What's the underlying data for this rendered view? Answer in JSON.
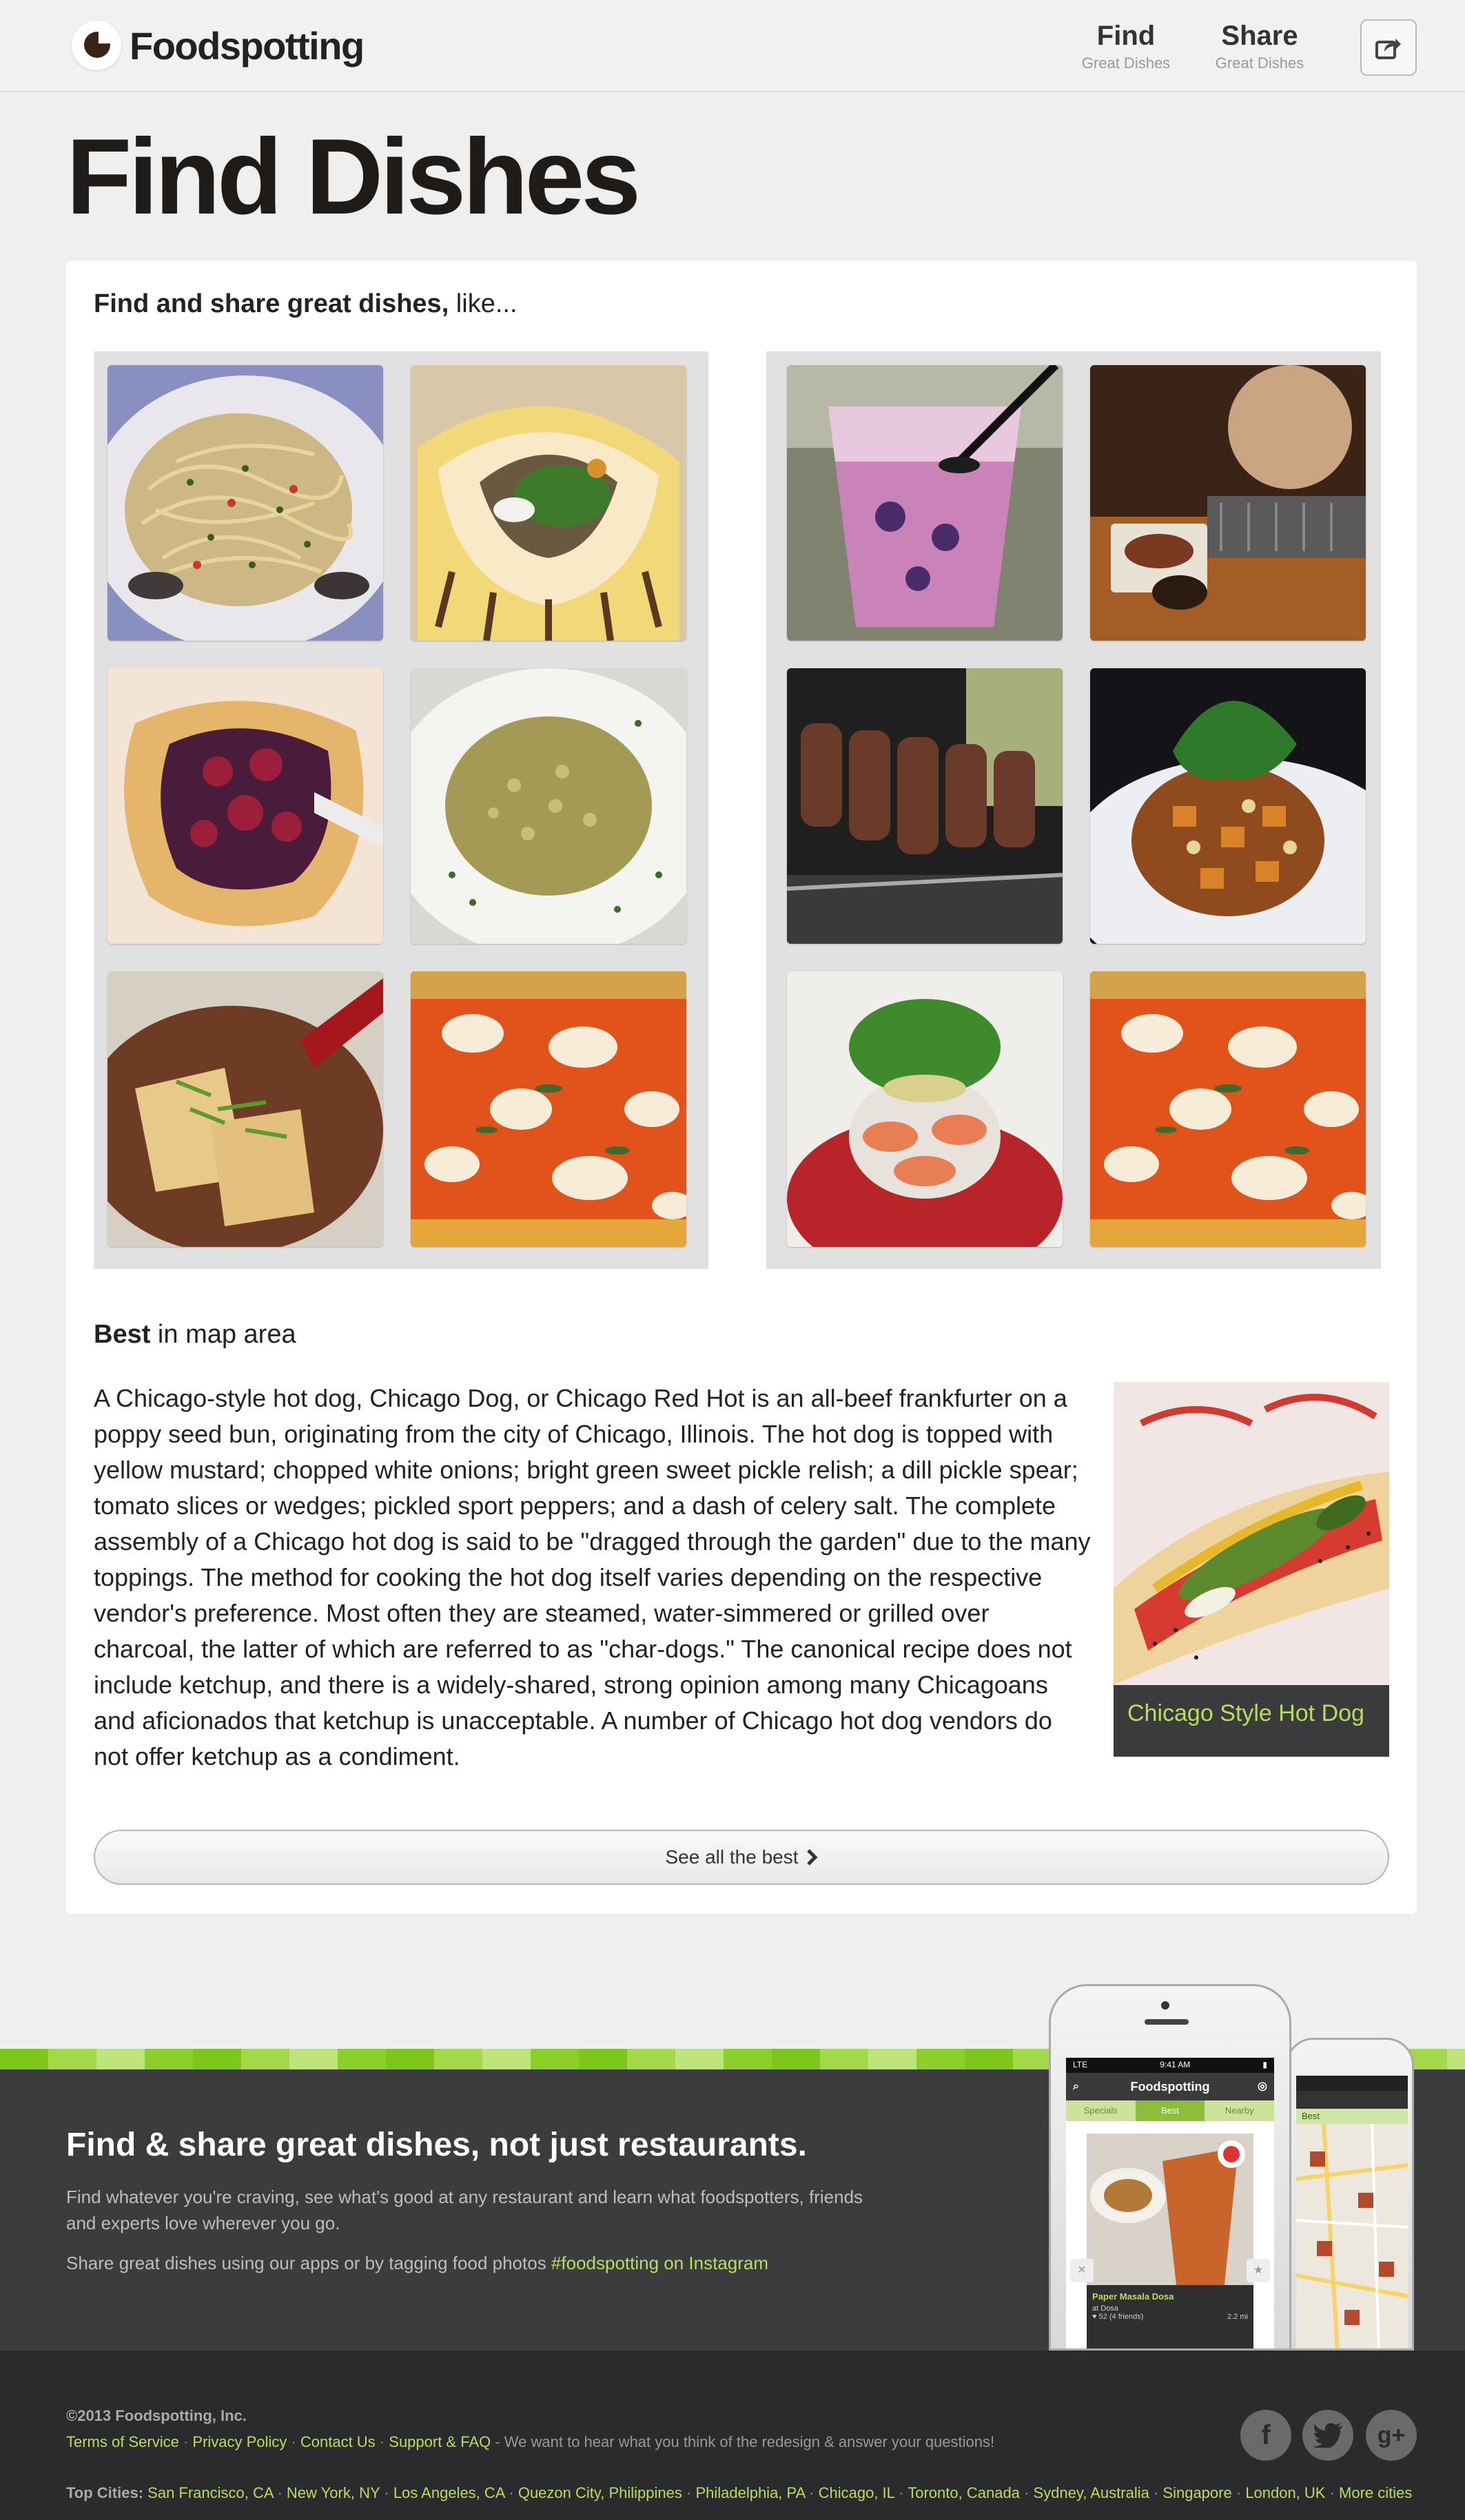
{
  "brand": {
    "name": "Foodspotting"
  },
  "nav": {
    "find": {
      "label": "Find",
      "sub": "Great Dishes"
    },
    "share": {
      "label": "Share",
      "sub": "Great Dishes"
    }
  },
  "page": {
    "title": "Find Dishes"
  },
  "intro": {
    "bold": "Find and share great dishes,",
    "rest": " like..."
  },
  "tiles": [
    "pasta",
    "gyro",
    "berry-tart",
    "risotto",
    "tofu",
    "pizza",
    "cocktail",
    "grill",
    "rotisserie",
    "salad-plate",
    "shrimp",
    "pizza"
  ],
  "best": {
    "heading_bold": "Best",
    "heading_rest": " in map area",
    "description": "A Chicago-style hot dog, Chicago Dog, or Chicago Red Hot is an all-beef frankfurter on a poppy seed bun, originating from the city of Chicago, Illinois. The hot dog is topped with yellow mustard; chopped white onions; bright green sweet pickle relish; a dill pickle spear; tomato slices or wedges; pickled sport peppers; and a dash of celery salt. The complete assembly of a Chicago hot dog is said to be \"dragged through the garden\" due to the many toppings. The method for cooking the hot dog itself varies depending on the respective vendor's preference. Most often they are steamed, water-simmered or grilled over charcoal, the latter of which are referred to as \"char-dogs.\" The canonical recipe does not include ketchup, and there is a widely-shared, strong opinion among many Chicagoans and aficionados that ketchup is unacceptable. A number of Chicago hot dog vendors do not offer ketchup as a condiment.",
    "photo_caption": "Chicago Style Hot Dog",
    "see_all": "See all the best"
  },
  "promo": {
    "title": "Find & share great dishes, not just restaurants.",
    "text": "Find whatever you're craving, see what's good at any restaurant and learn what foodspotters, friends and experts love wherever you go.",
    "share_text": "Share great dishes using our apps or by tagging food photos ",
    "share_link": "#foodspotting on Instagram"
  },
  "phone": {
    "carrier": "LTE",
    "time": "9:41 AM",
    "app_title": "Foodspotting",
    "tabs": [
      "Specials",
      "Best",
      "Nearby"
    ],
    "dish_name": "Paper Masala Dosa",
    "dish_place": "at Dosa",
    "dish_meta": "♥ 52 (4 friends)",
    "dish_distance": "2.2 mi",
    "small_tab": "Best"
  },
  "footer": {
    "copyright": "©2013 Foodspotting, Inc.",
    "links": [
      "Terms of Service",
      "Privacy Policy",
      "Contact Us",
      "Support & FAQ"
    ],
    "feedback": " - We want to hear what you think of the redesign & answer your questions!",
    "cities_label": "Top Cities:",
    "cities": [
      "San Francisco, CA",
      "New York, NY",
      "Los Angeles, CA",
      "Quezon City, Philippines",
      "Philadelphia, PA",
      "Chicago, IL",
      "Toronto, Canada",
      "Sydney, Australia",
      "Singapore",
      "London, UK",
      "More cities"
    ]
  },
  "social": [
    "facebook-icon",
    "twitter-icon",
    "google-plus-icon"
  ],
  "colors": {
    "accent_green": "#b9dd5e",
    "promo_bg": "#3c3c3f",
    "footer_bg": "#2b2b2e"
  }
}
